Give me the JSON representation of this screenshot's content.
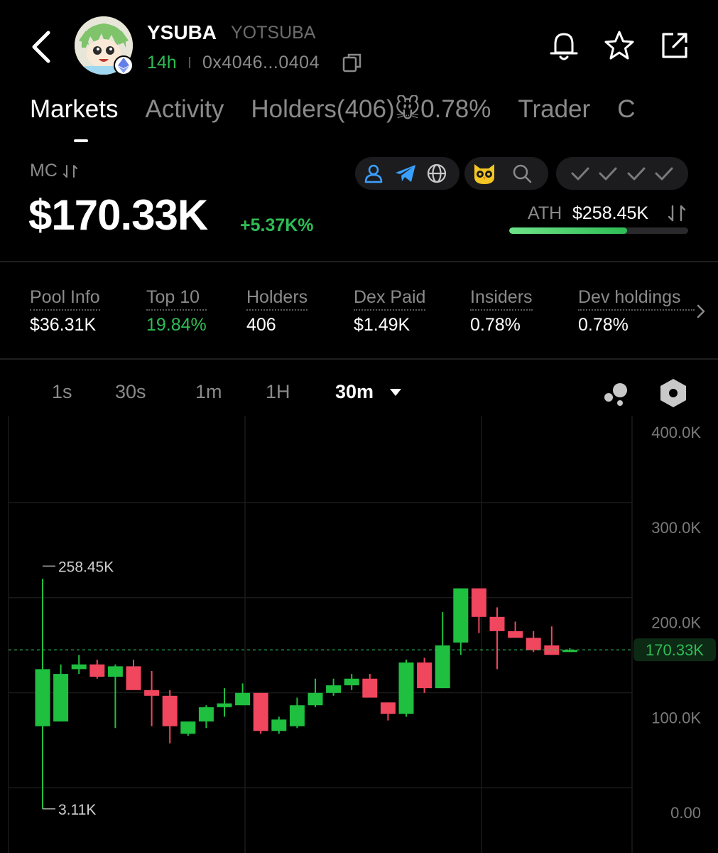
{
  "header": {
    "back_icon": "chevron-left-icon",
    "symbol": "YSUBA",
    "name": "YOTSUBA",
    "age": "14h",
    "address": "0x4046...0404",
    "chain_icon": "ethereum-icon"
  },
  "tabs": [
    {
      "label": "Markets",
      "active": true
    },
    {
      "label": "Activity"
    },
    {
      "label": "Holders(406)🐭0.78%"
    },
    {
      "label": "Trader"
    },
    {
      "label": "C"
    }
  ],
  "market": {
    "mc_label": "MC",
    "mc_value": "$170.33K",
    "mc_change": "+5.37K%",
    "ath_label": "ATH",
    "ath_value": "$258.45K",
    "ath_progress": 0.66
  },
  "stats": [
    {
      "label": "Pool Info",
      "value": "$36.31K"
    },
    {
      "label": "Top 10",
      "value": "19.84%",
      "green": true
    },
    {
      "label": "Holders",
      "value": "406"
    },
    {
      "label": "Dex Paid",
      "value": "$1.49K"
    },
    {
      "label": "Insiders",
      "value": "0.78%"
    },
    {
      "label": "Dev holdings",
      "value": "0.78%"
    }
  ],
  "timeframes": [
    "1s",
    "30s",
    "1m",
    "1H",
    "30m"
  ],
  "active_timeframe": "30m",
  "colors": {
    "up": "#1fbf3f",
    "down": "#f0465e",
    "accent_green": "#2ebd55",
    "muted": "#8a8a8a"
  },
  "chart_data": {
    "type": "candlestick",
    "y_ticks": [
      "400.0K",
      "300.0K",
      "200.0K",
      "100.0K",
      "0.00"
    ],
    "ylim": [
      0,
      400000
    ],
    "current_price_label": "170.33K",
    "current_price": 170330,
    "max_label": "258.45K",
    "min_label": "3.11K",
    "candles": [
      {
        "o": 90000,
        "h": 245000,
        "l": 3110,
        "c": 150000
      },
      {
        "o": 95000,
        "h": 155000,
        "l": 95000,
        "c": 145000
      },
      {
        "o": 150000,
        "h": 165000,
        "l": 145000,
        "c": 155000
      },
      {
        "o": 155000,
        "h": 160000,
        "l": 140000,
        "c": 142000
      },
      {
        "o": 142000,
        "h": 155000,
        "l": 88000,
        "c": 153000
      },
      {
        "o": 153000,
        "h": 160000,
        "l": 128000,
        "c": 128000
      },
      {
        "o": 128000,
        "h": 148000,
        "l": 90000,
        "c": 122000
      },
      {
        "o": 122000,
        "h": 128000,
        "l": 72000,
        "c": 90000
      },
      {
        "o": 82000,
        "h": 95000,
        "l": 80000,
        "c": 95000
      },
      {
        "o": 95000,
        "h": 112000,
        "l": 88000,
        "c": 110000
      },
      {
        "o": 110000,
        "h": 130000,
        "l": 100000,
        "c": 114000
      },
      {
        "o": 112000,
        "h": 135000,
        "l": 112000,
        "c": 125000
      },
      {
        "o": 125000,
        "h": 125000,
        "l": 82000,
        "c": 85000
      },
      {
        "o": 85000,
        "h": 100000,
        "l": 82000,
        "c": 97000
      },
      {
        "o": 90000,
        "h": 120000,
        "l": 88000,
        "c": 112000
      },
      {
        "o": 112000,
        "h": 140000,
        "l": 110000,
        "c": 125000
      },
      {
        "o": 125000,
        "h": 140000,
        "l": 122000,
        "c": 133000
      },
      {
        "o": 133000,
        "h": 145000,
        "l": 128000,
        "c": 140000
      },
      {
        "o": 140000,
        "h": 145000,
        "l": 120000,
        "c": 120000
      },
      {
        "o": 115000,
        "h": 115000,
        "l": 96000,
        "c": 103000
      },
      {
        "o": 103000,
        "h": 160000,
        "l": 100000,
        "c": 157000
      },
      {
        "o": 157000,
        "h": 162000,
        "l": 125000,
        "c": 130000
      },
      {
        "o": 130000,
        "h": 210000,
        "l": 130000,
        "c": 175000
      },
      {
        "o": 178000,
        "h": 235000,
        "l": 165000,
        "c": 235000
      },
      {
        "o": 235000,
        "h": 235000,
        "l": 188000,
        "c": 205000
      },
      {
        "o": 205000,
        "h": 215000,
        "l": 150000,
        "c": 190000
      },
      {
        "o": 190000,
        "h": 200000,
        "l": 183000,
        "c": 183000
      },
      {
        "o": 183000,
        "h": 190000,
        "l": 168000,
        "c": 170000
      },
      {
        "o": 175000,
        "h": 195000,
        "l": 165000,
        "c": 165000
      },
      {
        "o": 168000,
        "h": 172000,
        "l": 168000,
        "c": 170330
      }
    ]
  }
}
